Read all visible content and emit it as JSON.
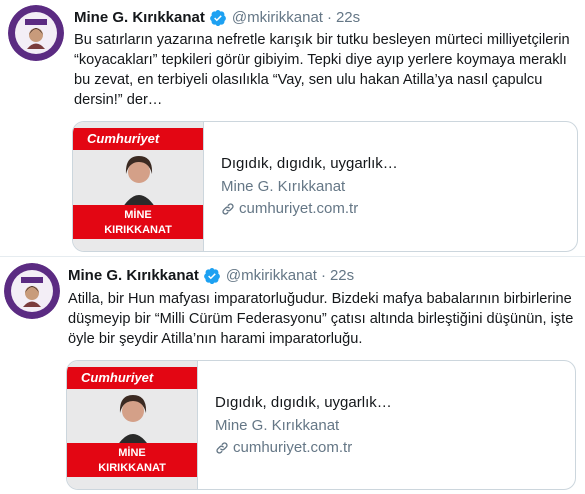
{
  "tweets": [
    {
      "author_name": "Mine G. Kırıkkanat",
      "handle": "@mkirikkanat",
      "separator": "·",
      "time": "22s",
      "text": "Bu satırların yazarına nefretle karışık bir tutku besleyen mürteci milliyetçilerin “koyacakları” tepkileri görür gibiyim. Tepki diye ayıp yerlere koymaya meraklı bu zevat, en terbiyeli olasılıkla “Vay, sen ulu hakan Atilla’ya nasıl çapulcu dersin!” der…",
      "card": {
        "brand": "Cumhuriyet",
        "overlay_line1": "MİNE",
        "overlay_line2": "KIRIKKANAT",
        "title": "Dıgıdık, dıgıdık, uygarlık…",
        "description": "Mine G. Kırıkkanat",
        "domain": "cumhuriyet.com.tr"
      }
    },
    {
      "author_name": "Mine G. Kırıkkanat",
      "handle": "@mkirikkanat",
      "separator": "·",
      "time": "22s",
      "text": "Atilla, bir Hun mafyası imparatorluğudur. Bizdeki mafya babalarının birbirlerine düşmeyip bir “Milli Cürüm Federasyonu” çatısı altında birleştiğini düşünün, işte öyle bir şeydir Atilla’nın harami imparatorluğu.",
      "card": {
        "brand": "Cumhuriyet",
        "overlay_line1": "MİNE",
        "overlay_line2": "KIRIKKANAT",
        "title": "Dıgıdık, dıgıdık, uygarlık…",
        "description": "Mine G. Kırıkkanat",
        "domain": "cumhuriyet.com.tr"
      }
    }
  ],
  "colors": {
    "verified": "#1da1f2",
    "secondary_text": "#657786",
    "brand_red": "#e30613",
    "avatar_purple": "#5b2b82"
  },
  "icons": {
    "verified": "verified-badge-icon",
    "link": "link-icon"
  }
}
